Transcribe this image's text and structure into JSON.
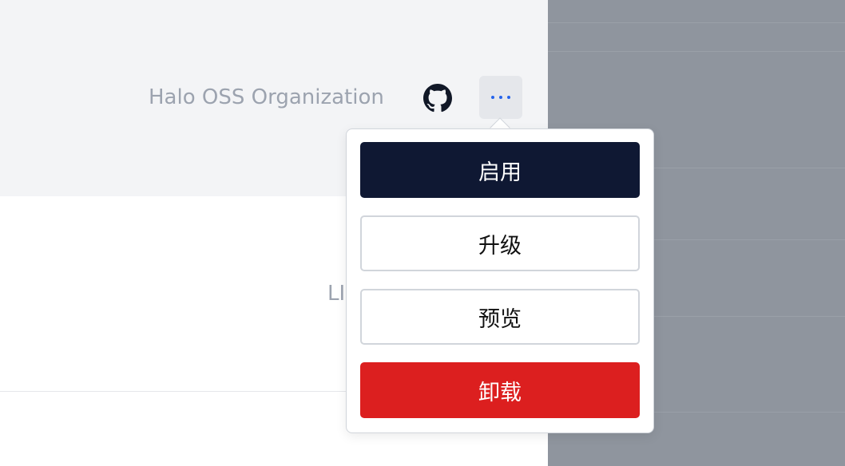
{
  "header": {
    "author": "Halo OSS Organization",
    "github_icon": "github-icon",
    "more_icon": "more-dots-icon"
  },
  "content": {
    "partial_label": "LI"
  },
  "menu": {
    "enable_label": "启用",
    "upgrade_label": "升级",
    "preview_label": "预览",
    "uninstall_label": "卸载"
  },
  "colors": {
    "primary": "#0f1833",
    "danger": "#dc1f1f",
    "accent": "#2563eb",
    "overlay": "#8f959e"
  }
}
